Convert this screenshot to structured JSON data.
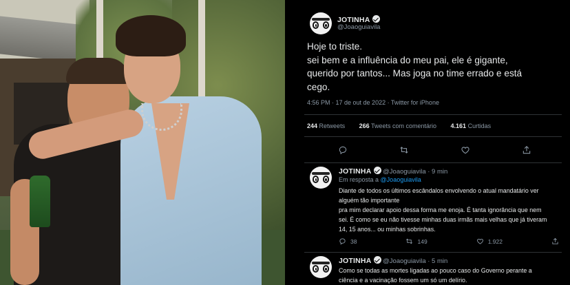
{
  "tweet": {
    "display_name": "JOTINHA",
    "handle": "@Joaoguiavila",
    "text_lines": [
      "Hoje to triste.",
      "sei bem e a influência do meu pai, ele é gigante,",
      "querido por tantos... Mas joga no time errado e está",
      "cego."
    ],
    "timestamp": "4:56 PM · 17 de out de 2022 · Twitter for iPhone",
    "retweets_count": "244",
    "retweets_label": "Retweets",
    "quotes_count": "266",
    "quotes_label": "Tweets com comentário",
    "likes_count": "4.161",
    "likes_label": "Curtidas"
  },
  "replies": [
    {
      "display_name": "JOTINHA",
      "handle_time": "@Joaoguiavila · 9 min",
      "replying_prefix": "Em resposta a",
      "replying_to": "@Joaoguiavila",
      "body_lines": [
        "Diante de todos os últimos escândalos envolvendo o atual mandatário ver",
        "alguém tão importante",
        "pra mim declarar apoio dessa forma  me enoja. É tanta ignorância que nem",
        "sei. É como se eu não tivesse minhas duas irmãs mais velhas que já tiveram",
        "14, 15 anos... ou minhas sobrinhas."
      ],
      "reply_count": "38",
      "retweet_count": "149",
      "like_count": "1.922"
    },
    {
      "display_name": "JOTINHA",
      "handle_time": "@Joaoguiavila · 5 min",
      "body_lines": [
        "Como se todas as mortes ligadas ao pouco caso do Governo perante a",
        "ciência e a vacinação fossem um só um delírio."
      ]
    }
  ],
  "icons": {
    "reply": "reply-icon",
    "retweet": "retweet-icon",
    "like": "heart-icon",
    "share": "share-icon",
    "verified": "verified-badge-icon"
  },
  "colors": {
    "background": "#000000",
    "text": "#e7e9ea",
    "muted": "#8b98a5",
    "link": "#1d9bf0",
    "divider": "#2f3336"
  }
}
